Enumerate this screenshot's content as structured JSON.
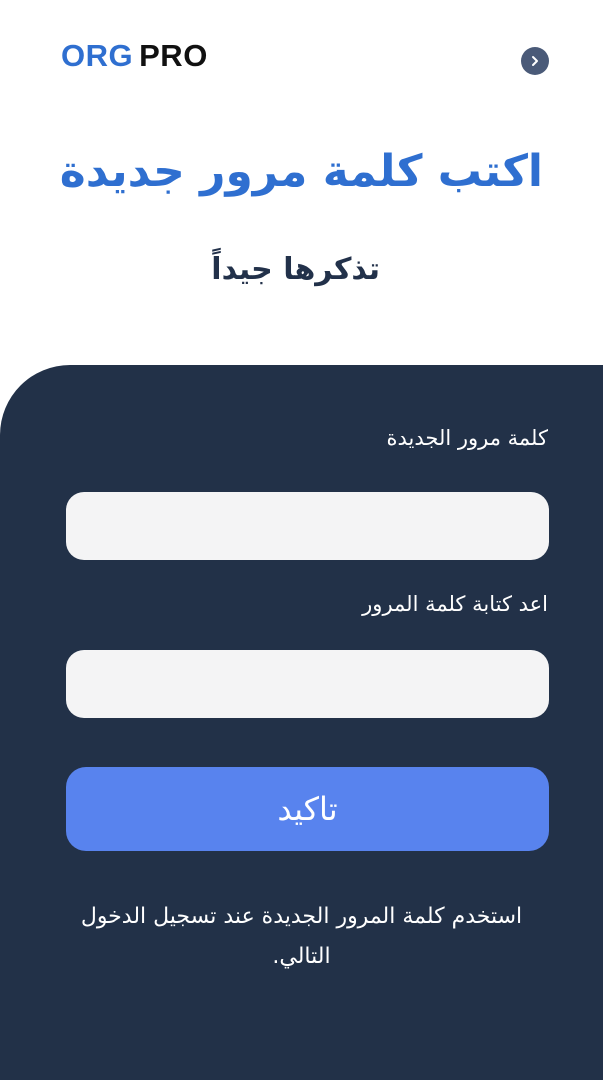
{
  "header": {
    "logo_part1": "ORG",
    "logo_part2": "PRO",
    "back_icon": "chevron-right-icon"
  },
  "hero": {
    "title": "اكتب كلمة مرور جديدة",
    "subtitle": "تذكرها جيداً"
  },
  "form": {
    "new_password_label": "كلمة مرور الجديدة",
    "new_password_value": "",
    "confirm_password_label": "اعد كتابة كلمة المرور",
    "confirm_password_value": "",
    "submit_label": "تاكيد",
    "note": "استخدم كلمة المرور الجديدة عند تسجيل الدخول التالي."
  },
  "colors": {
    "brand_blue": "#2f6fd0",
    "panel_bg": "#223148",
    "button_bg": "#5883ee",
    "back_button_bg": "#4a5a78",
    "input_bg": "#f4f4f5"
  }
}
